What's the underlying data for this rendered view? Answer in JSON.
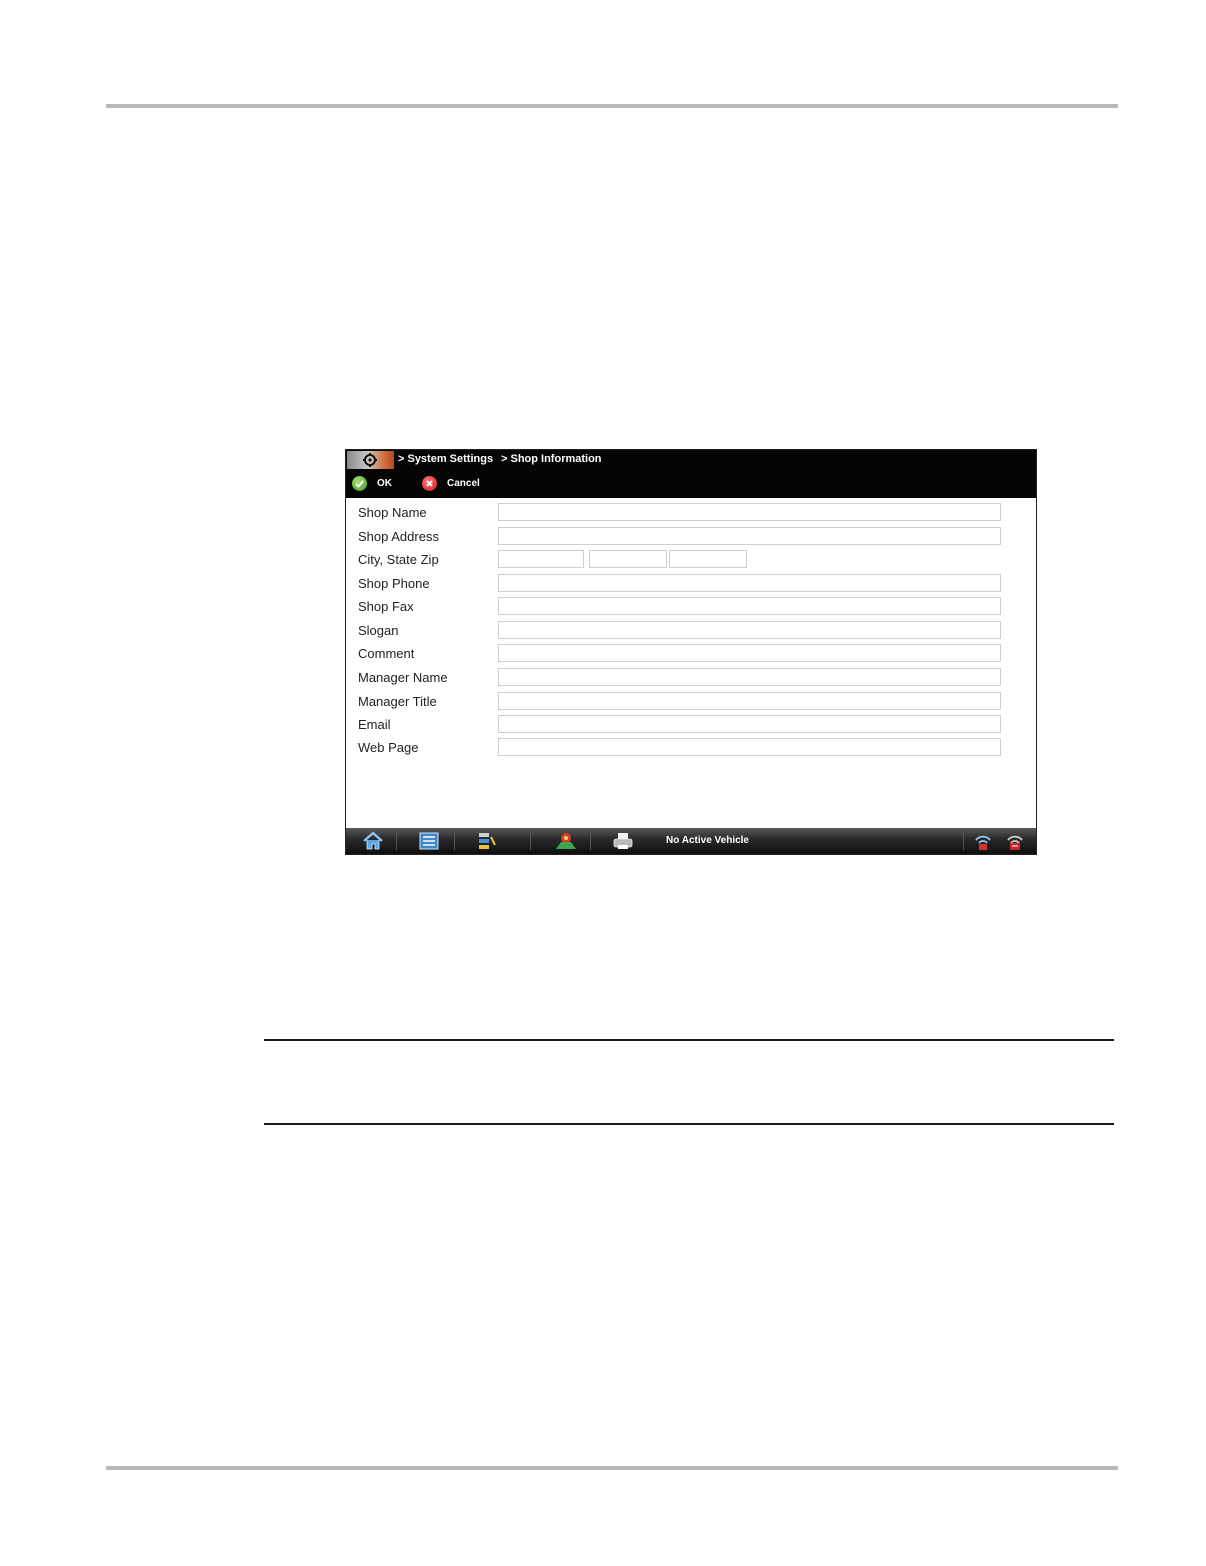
{
  "header": {
    "home_icon": "home-settings-icon",
    "crumbs": [
      "> System Settings",
      "> Shop Information"
    ]
  },
  "toolbar": {
    "ok_label": "OK",
    "cancel_label": "Cancel"
  },
  "form": {
    "fields": [
      {
        "label": "Shop Name",
        "value": ""
      },
      {
        "label": "Shop Address",
        "value": ""
      },
      {
        "label": "City, State Zip",
        "city": "",
        "state": "",
        "zip": ""
      },
      {
        "label": "Shop Phone",
        "value": ""
      },
      {
        "label": "Shop Fax",
        "value": ""
      },
      {
        "label": "Slogan",
        "value": ""
      },
      {
        "label": "Comment",
        "value": ""
      },
      {
        "label": "Manager Name",
        "value": ""
      },
      {
        "label": "Manager Title",
        "value": ""
      },
      {
        "label": "Email",
        "value": ""
      },
      {
        "label": "Web Page",
        "value": ""
      }
    ]
  },
  "status_bar": {
    "status_text": "No Active Vehicle",
    "icons": [
      "home-icon",
      "data-list-icon",
      "tools-icon",
      "vehicle-system-icon",
      "printer-icon",
      "wireless-icon",
      "connection-icon"
    ]
  },
  "colors": {
    "ok_green": "#3e9a1e",
    "cancel_red": "#d4141c",
    "topbar": "#050505"
  }
}
